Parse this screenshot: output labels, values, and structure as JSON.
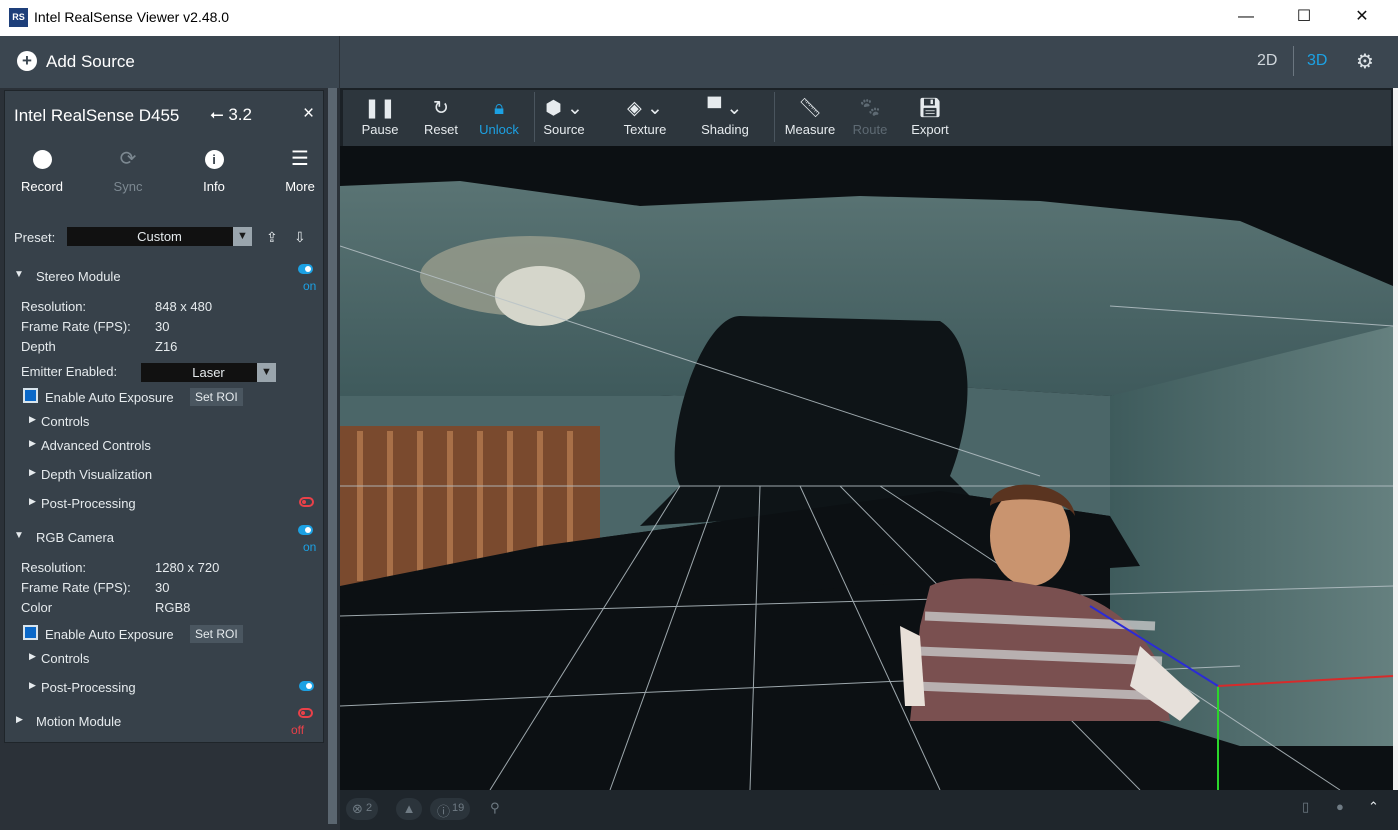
{
  "window": {
    "title": "Intel RealSense Viewer v2.48.0",
    "app_icon": "RS",
    "minimize": "—",
    "maximize": "☐",
    "close": "✕"
  },
  "topbar": {
    "add_source": "Add Source",
    "mode_2d": "2D",
    "mode_3d": "3D",
    "accent": "#1ca1e3"
  },
  "device": {
    "name": "Intel RealSense D455",
    "usb": "3.2",
    "buttons": {
      "record": "Record",
      "sync": "Sync",
      "info": "Info",
      "more": "More"
    },
    "preset": {
      "label": "Preset:",
      "value": "Custom"
    },
    "stereo": {
      "title": "Stereo Module",
      "state": "on",
      "resolution_label": "Resolution:",
      "resolution": "848 x 480",
      "fps_label": "Frame Rate (FPS):",
      "fps": "30",
      "format_label": "Depth",
      "format": "Z16",
      "emitter_label": "Emitter Enabled:",
      "emitter": "Laser",
      "auto_exposure": "Enable Auto Exposure",
      "set_roi": "Set ROI",
      "controls": "Controls",
      "advanced": "Advanced Controls",
      "depth_vis": "Depth Visualization",
      "post": "Post-Processing"
    },
    "rgb": {
      "title": "RGB Camera",
      "state": "on",
      "resolution_label": "Resolution:",
      "resolution": "1280 x 720",
      "fps_label": "Frame Rate (FPS):",
      "fps": "30",
      "format_label": "Color",
      "format": "RGB8",
      "auto_exposure": "Enable Auto Exposure",
      "set_roi": "Set ROI",
      "controls": "Controls",
      "post": "Post-Processing"
    },
    "motion": {
      "title": "Motion Module",
      "state": "off"
    }
  },
  "toolbar": {
    "pause": "Pause",
    "reset": "Reset",
    "unlock": "Unlock",
    "source": "Source",
    "texture": "Texture",
    "shading": "Shading",
    "measure": "Measure",
    "route": "Route",
    "export": "Export"
  },
  "status": {
    "errors": "2",
    "info_count": "19"
  }
}
